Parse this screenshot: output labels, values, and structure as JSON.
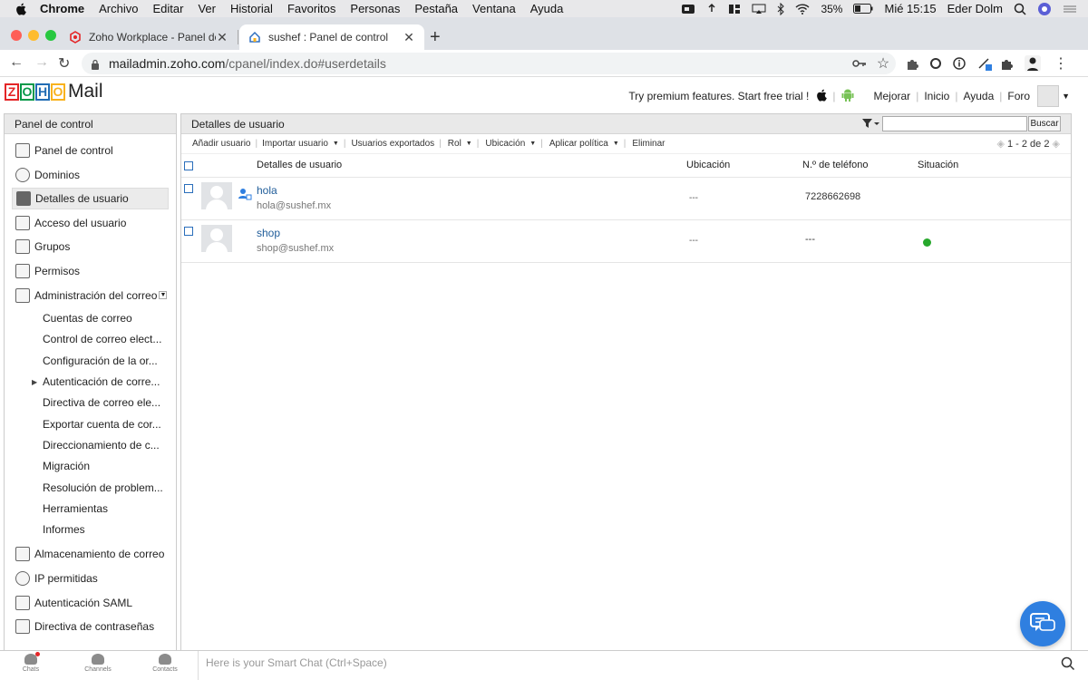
{
  "menubar": {
    "app": "Chrome",
    "items": [
      "Archivo",
      "Editar",
      "Ver",
      "Historial",
      "Favoritos",
      "Personas",
      "Pestaña",
      "Ventana",
      "Ayuda"
    ],
    "battery": "35%",
    "clock": "Mié 15:15",
    "user": "Eder Dolm"
  },
  "browser": {
    "tabs": [
      {
        "title": "Zoho Workplace - Panel de con",
        "active": false
      },
      {
        "title": "sushef : Panel de control",
        "active": true
      }
    ],
    "url_host": "mailadmin.zoho.com",
    "url_path": "/cpanel/index.do#userdetails"
  },
  "header": {
    "logo_letters": [
      "Z",
      "O",
      "H",
      "O"
    ],
    "logo_colors": [
      "#e42527",
      "#089949",
      "#226db4",
      "#f9b21d"
    ],
    "logo_word": "Mail",
    "premium_text": "Try premium features. Start free trial !",
    "links": [
      "Mejorar",
      "Inicio",
      "Ayuda",
      "Foro"
    ]
  },
  "sidebar": {
    "title": "Panel de control",
    "items_top": [
      {
        "label": "Panel de control",
        "active": false
      },
      {
        "label": "Dominios",
        "active": false
      },
      {
        "label": "Detalles de usuario",
        "active": true
      },
      {
        "label": "Acceso del usuario",
        "active": false
      },
      {
        "label": "Grupos",
        "active": false
      },
      {
        "label": "Permisos",
        "active": false
      },
      {
        "label": "Administración del correo",
        "active": false
      }
    ],
    "sub_items": [
      "Cuentas de correo",
      "Control de correo elect...",
      "Configuración de la or...",
      "Autenticación de corre...",
      "Directiva de correo ele...",
      "Exportar cuenta de cor...",
      "Direccionamiento de c...",
      "Migración",
      "Resolución de problem...",
      "Herramientas",
      "Informes"
    ],
    "items_bottom": [
      "Almacenamiento de correo",
      "IP permitidas",
      "Autenticación SAML",
      "Directiva de contraseñas"
    ]
  },
  "main": {
    "title": "Detalles de usuario",
    "search_button": "Buscar",
    "actions": [
      "Añadir usuario",
      "Importar usuario",
      "Usuarios exportados",
      "Rol",
      "Ubicación",
      "Aplicar política",
      "Eliminar"
    ],
    "pager": "1 - 2 de 2",
    "columns": [
      "Detalles de usuario",
      "Ubicación",
      "N.º de teléfono",
      "Situación"
    ],
    "rows": [
      {
        "name": "hola",
        "email": "hola@sushef.mx",
        "location": "---",
        "phone": "7228662698",
        "status": ""
      },
      {
        "name": "shop",
        "email": "shop@sushef.mx",
        "location": "---",
        "phone": "---",
        "status": "active"
      }
    ]
  },
  "bottombar": {
    "items": [
      "Chats",
      "Channels",
      "Contacts"
    ],
    "smartchat_placeholder": "Here is your Smart Chat (Ctrl+Space)"
  },
  "colors": {
    "status_active": "#27a82c",
    "chat_fab": "#2f7fe0",
    "link": "#1f5c99"
  }
}
